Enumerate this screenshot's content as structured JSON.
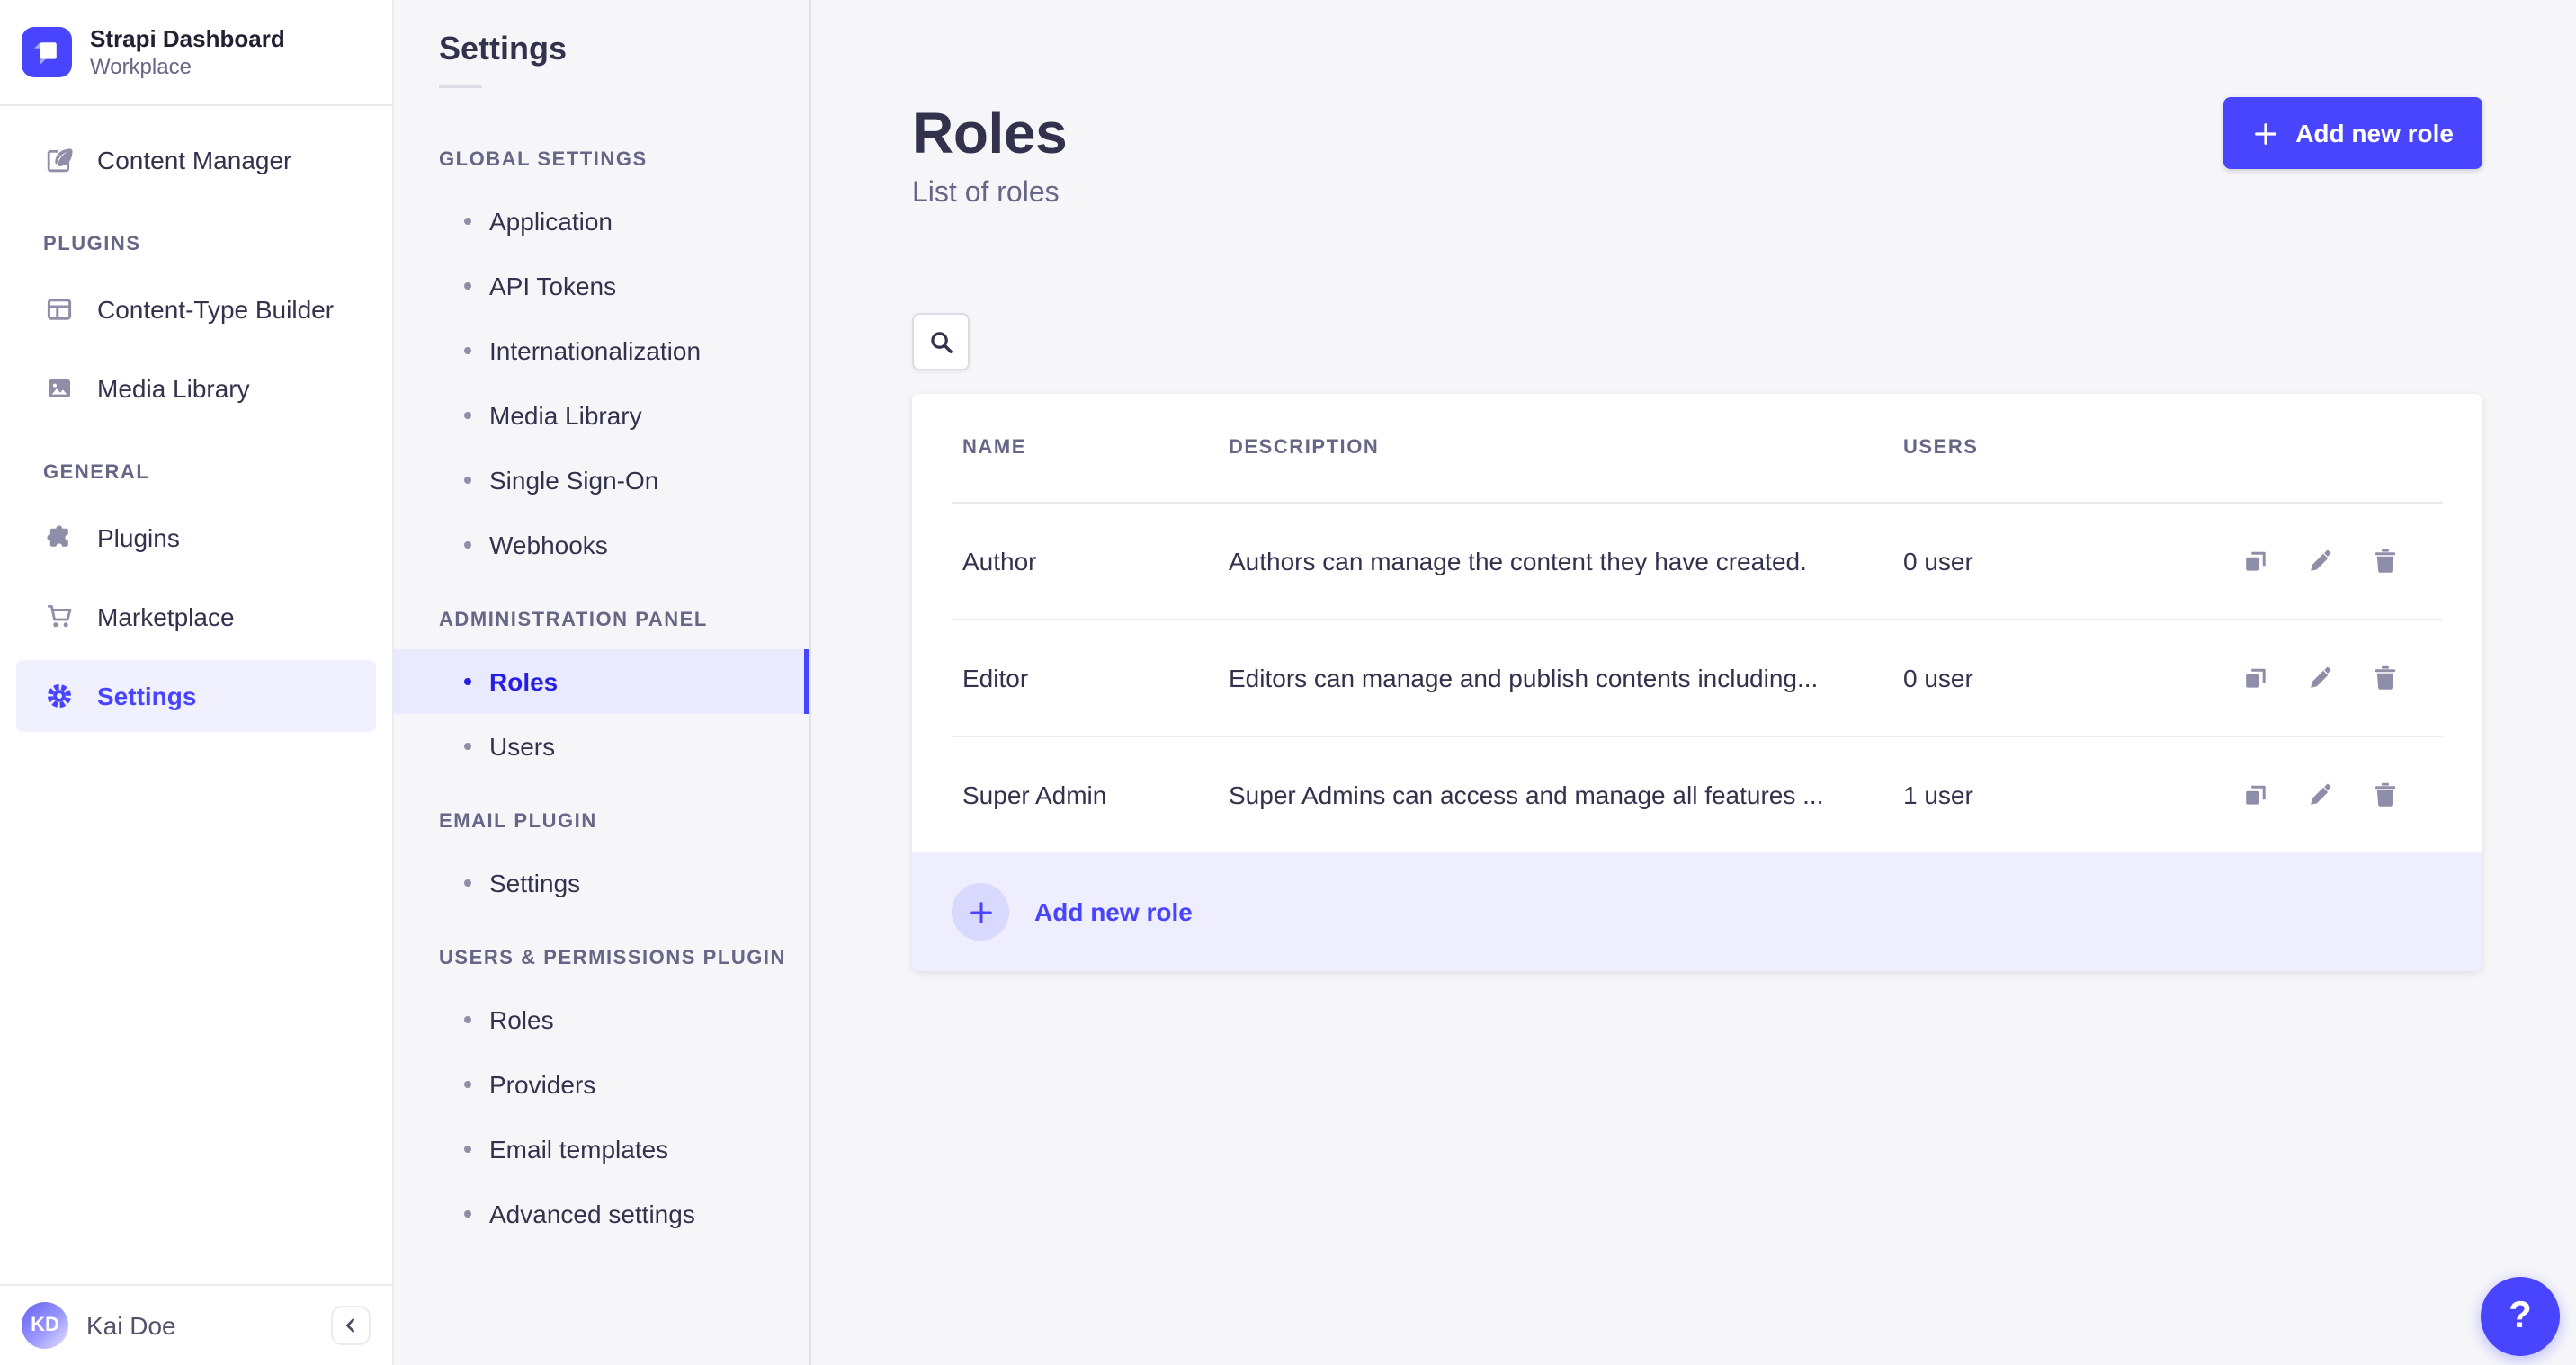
{
  "colors": {
    "primary": "#4945ff",
    "primary_dark": "#271fe0",
    "active_bg": "#f0f0ff",
    "subnav_active_bg": "#eaeaff",
    "text_dark": "#32324d",
    "text_muted": "#666687",
    "surface": "#ffffff",
    "background": "#f6f6f9"
  },
  "brand": {
    "title": "Strapi Dashboard",
    "subtitle": "Workplace",
    "logo_icon": "strapi-logo"
  },
  "nav": {
    "content_manager": "Content Manager",
    "plugins_section": "PLUGINS",
    "content_type_builder": "Content-Type Builder",
    "media_library": "Media Library",
    "general_section": "GENERAL",
    "plugins": "Plugins",
    "marketplace": "Marketplace",
    "settings": "Settings",
    "user_initials": "KD",
    "user_name": "Kai Doe"
  },
  "subnav": {
    "title": "Settings",
    "active_item": "Roles",
    "sections": [
      {
        "label": "GLOBAL SETTINGS",
        "items": [
          "Application",
          "API Tokens",
          "Internationalization",
          "Media Library",
          "Single Sign-On",
          "Webhooks"
        ]
      },
      {
        "label": "ADMINISTRATION PANEL",
        "items": [
          "Roles",
          "Users"
        ]
      },
      {
        "label": "EMAIL PLUGIN",
        "items": [
          "Settings"
        ]
      },
      {
        "label": "USERS & PERMISSIONS PLUGIN",
        "items": [
          "Roles",
          "Providers",
          "Email templates",
          "Advanced settings"
        ]
      }
    ]
  },
  "page": {
    "title": "Roles",
    "subtitle": "List of roles",
    "add_button_label": "Add new role",
    "search_icon": "search-icon"
  },
  "table": {
    "headers": {
      "name": "NAME",
      "description": "DESCRIPTION",
      "users": "USERS"
    },
    "rows": [
      {
        "name": "Author",
        "description": "Authors can manage the content they have created.",
        "users": "0 user"
      },
      {
        "name": "Editor",
        "description": "Editors can manage and publish contents including...",
        "users": "0 user"
      },
      {
        "name": "Super Admin",
        "description": "Super Admins can access and manage all features ...",
        "users": "1 user"
      }
    ],
    "row_action_icons": [
      "duplicate-icon",
      "edit-icon",
      "delete-icon"
    ],
    "footer_add_label": "Add new role"
  },
  "help_button_label": "?"
}
